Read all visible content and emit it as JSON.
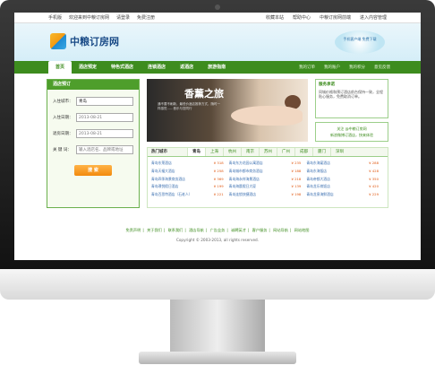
{
  "topbar": {
    "items": [
      "手机版",
      "欢迎来到中粮订房网",
      "请登录",
      "免费注册"
    ],
    "right": [
      "收藏本站",
      "帮助中心",
      "中粮订房网前端",
      "进入内容管理"
    ]
  },
  "header": {
    "logo_text": "中粮订房网",
    "promo_text": "手机客户端 免费下载"
  },
  "nav": {
    "items": [
      "首页",
      "酒店预定",
      "特色式酒店",
      "连锁酒店",
      "返酒店",
      "旅游指南"
    ],
    "links": [
      "我的订单",
      "我的账户",
      "我的积分",
      "意见反馈"
    ]
  },
  "search": {
    "title": "酒店预订",
    "city_label": "入住城市：",
    "city_value": "青岛",
    "checkin_label": "入住日期：",
    "checkin_value": "2013-08-21",
    "checkout_label": "退房日期：",
    "checkout_value": "2013-08-21",
    "keyword_label": "关 键 词：",
    "keyword_placeholder": "输入酒店名、品牌或地址",
    "button": "搜 索"
  },
  "banner": {
    "title": "香薰之旅",
    "subtitle": "通不要不刷新，最低价酒店推荐方式，随时一样感觉……音乐与您同行"
  },
  "side": {
    "title": "服务承诺",
    "text": "同城价格和预订酒店前台保持一致，全程贴心服务，免费取消订单。",
    "follow": "关注 @中粮订房网",
    "follow2": "新浪微博订酒店，快来体验"
  },
  "cities": {
    "hot_label": "热门城市",
    "tabs": [
      "青岛",
      "上海",
      "杭州",
      "南京",
      "苏州",
      "广州",
      "成都",
      "厦门",
      "深圳"
    ],
    "hotels": [
      {
        "name": "青岛东莱酒店",
        "price": "¥ 318"
      },
      {
        "name": "青岛东方花园公寓酒店",
        "price": "¥ 235"
      },
      {
        "name": "青岛东海宴酒店",
        "price": "¥ 288"
      },
      {
        "name": "青岛天福大酒店",
        "price": "¥ 258"
      },
      {
        "name": "青岛城市都市商务酒店",
        "price": "¥ 188"
      },
      {
        "name": "青岛东海饭店",
        "price": "¥ 428"
      },
      {
        "name": "青岛四季海景商务酒店",
        "price": "¥ 369"
      },
      {
        "name": "青岛海永祥海景酒店",
        "price": "¥ 218"
      },
      {
        "name": "青岛帝都大酒店",
        "price": "¥ 350"
      },
      {
        "name": "青岛璟悦假日酒店",
        "price": "¥ 199"
      },
      {
        "name": "青岛海晨假日大厦",
        "price": "¥ 139"
      },
      {
        "name": "青岛龙乐缤饭店",
        "price": "¥ 420"
      },
      {
        "name": "青岛百思特酒店（石老人）",
        "price": "¥ 221"
      },
      {
        "name": "青岛连锁快捷酒店",
        "price": "¥ 198"
      },
      {
        "name": "青岛龙泉海鲜酒店",
        "price": "¥ 229"
      }
    ]
  },
  "footer": {
    "links": [
      "免责声明",
      "关于我们",
      "联系我们",
      "酒店导航",
      "广告业务",
      "诚聘英才",
      "客户服务",
      "网站导航",
      "网站地图"
    ],
    "copyright": "Copyright © 2003-2013, all rights reserved."
  }
}
